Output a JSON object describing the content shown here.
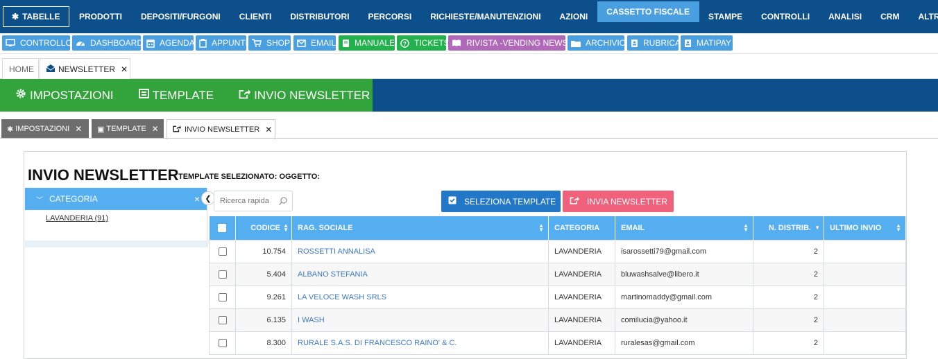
{
  "topnav": {
    "items": [
      "TABELLE",
      "PRODOTTI",
      "DEPOSITI/FURGONI",
      "CLIENTI",
      "DISTRIBUTORI",
      "PERCORSI",
      "RICHIESTE/MANUTENZIONI",
      "AZIONI",
      "CASSETTO FISCALE",
      "STAMPE",
      "CONTROLLI",
      "ANALISI",
      "CRM",
      "ALTRO"
    ],
    "active": "CASSETTO FISCALE"
  },
  "shortcuts": [
    {
      "label": "CONTROLLO",
      "icon": "monitor-icon",
      "color": "#4a9fe0"
    },
    {
      "label": "DASHBOARD",
      "icon": "dashboard-gauge-icon",
      "color": "#4a9fe0"
    },
    {
      "label": "AGENDA",
      "icon": "calendar-icon",
      "color": "#4a9fe0"
    },
    {
      "label": "APPUNTI",
      "icon": "clipboard-icon",
      "color": "#4a9fe0"
    },
    {
      "label": "SHOP",
      "icon": "cart-icon",
      "color": "#4a9fe0"
    },
    {
      "label": "EMAIL",
      "icon": "envelope-icon",
      "color": "#4a9fe0"
    },
    {
      "label": "MANUALE",
      "icon": "book-icon",
      "color": "#22b14c"
    },
    {
      "label": "TICKETS",
      "icon": "question-circle-icon",
      "color": "#22b14c"
    },
    {
      "label": "RIVISTA -VENDING NEWS-",
      "icon": "open-book-icon",
      "color": "#b069b9"
    },
    {
      "label": "ARCHIVIO",
      "icon": "folder-icon",
      "color": "#4a9fe0"
    },
    {
      "label": "RUBRICA",
      "icon": "address-book-icon",
      "color": "#4a9fe0"
    },
    {
      "label": "MATIPAY",
      "icon": "address-book-icon",
      "color": "#4a9fe0"
    }
  ],
  "pagetabs": {
    "home": "HOME",
    "newsletter": "NEWSLETTER"
  },
  "modules": {
    "impostazioni": "IMPOSTAZIONI",
    "template": "TEMPLATE",
    "invio": "INVIO NEWSLETTER"
  },
  "subtabs": {
    "impostazioni": "IMPOSTAZIONI",
    "template": "TEMPLATE",
    "invio": "INVIO NEWSLETTER"
  },
  "panel": {
    "title": "INVIO NEWSLETTER",
    "subtitle": "TEMPLATE SELEZIONATO: OGGETTO:"
  },
  "category": {
    "header": "CATEGORIA",
    "item": "LAVANDERIA (91)"
  },
  "search": {
    "placeholder": "Ricerca rapida"
  },
  "buttons": {
    "select_template": "SELEZIONA TEMPLATE",
    "send_newsletter": "INVIA NEWSLETTER"
  },
  "table": {
    "columns": [
      "CODICE",
      "RAG. SOCIALE",
      "CATEGORIA",
      "EMAIL",
      "N. DISTRIB.",
      "ULTIMO INVIO"
    ],
    "rows": [
      {
        "codice": "10.754",
        "rag": "ROSSETTI ANNALISA",
        "categoria": "LAVANDERIA",
        "email": "isarossetti79@gmail.com",
        "ndistrib": "2",
        "ultimo": ""
      },
      {
        "codice": "5.404",
        "rag": "ALBANO STEFANIA",
        "categoria": "LAVANDERIA",
        "email": "bluwashsalve@libero.it",
        "ndistrib": "2",
        "ultimo": ""
      },
      {
        "codice": "9.261",
        "rag": "LA VELOCE WASH SRLS",
        "categoria": "LAVANDERIA",
        "email": "martinomaddy@gmail.com",
        "ndistrib": "2",
        "ultimo": ""
      },
      {
        "codice": "6.135",
        "rag": "I WASH",
        "categoria": "LAVANDERIA",
        "email": "comilucia@yahoo.it",
        "ndistrib": "2",
        "ultimo": ""
      },
      {
        "codice": "8.300",
        "rag": "RURALE S.A.S. DI FRANCESCO RAINO' & C.",
        "categoria": "LAVANDERIA",
        "email": "ruralesas@gmail.com",
        "ndistrib": "2",
        "ultimo": ""
      }
    ]
  }
}
